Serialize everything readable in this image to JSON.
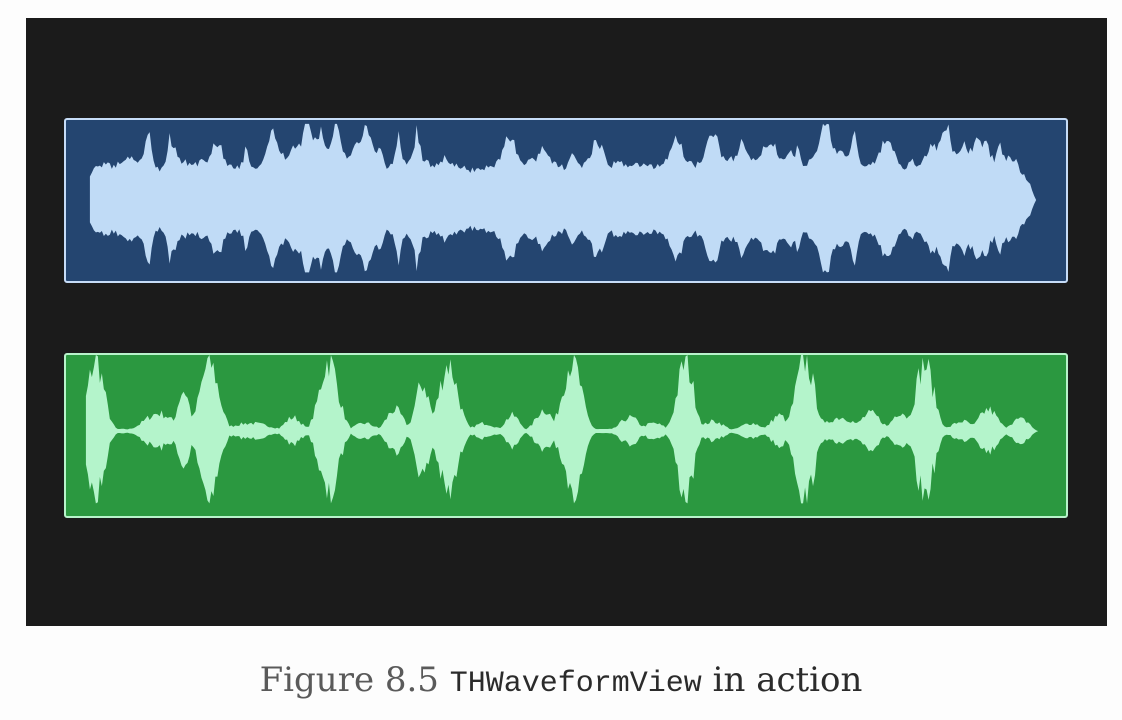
{
  "figure": {
    "caption_prefix": "Figure 8.5",
    "caption_code": "THWaveformView",
    "caption_suffix": "in action"
  },
  "waveforms": [
    {
      "name": "music-waveform",
      "panel_color": "#244570",
      "wave_color": "#c0dbf6",
      "border_color": "#c6dcf7"
    },
    {
      "name": "speech-waveform",
      "panel_color": "#2b9840",
      "wave_color": "#b4f4cb",
      "border_color": "#b8f3cb"
    }
  ]
}
